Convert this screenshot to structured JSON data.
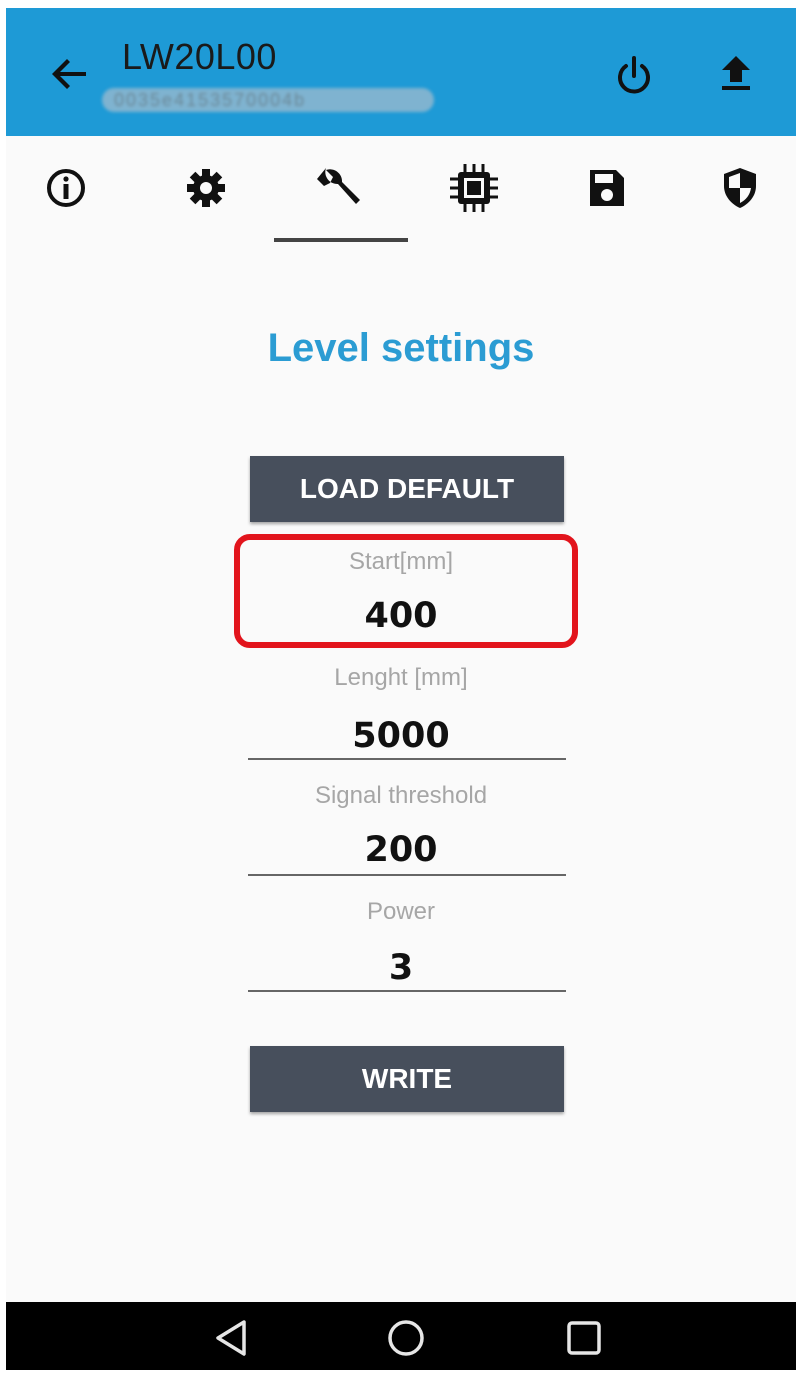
{
  "appbar": {
    "title": "LW20L00",
    "subtitle": "0035e4153570004b"
  },
  "tabs": [
    {
      "name": "info"
    },
    {
      "name": "settings"
    },
    {
      "name": "tools",
      "active": true
    },
    {
      "name": "chip"
    },
    {
      "name": "save"
    },
    {
      "name": "security"
    }
  ],
  "page": {
    "heading": "Level settings",
    "load_default_label": "LOAD DEFAULT",
    "write_label": "WRITE"
  },
  "fields": {
    "start": {
      "label": "Start[mm]",
      "value": "400"
    },
    "length": {
      "label": "Lenght [mm]",
      "value": "5000"
    },
    "threshold": {
      "label": "Signal threshold",
      "value": "200"
    },
    "power": {
      "label": "Power",
      "value": "3"
    }
  },
  "colors": {
    "appbar": "#1e9ad6",
    "heading": "#2b9cd3",
    "button": "#474f5c",
    "highlight": "#e2141c"
  }
}
